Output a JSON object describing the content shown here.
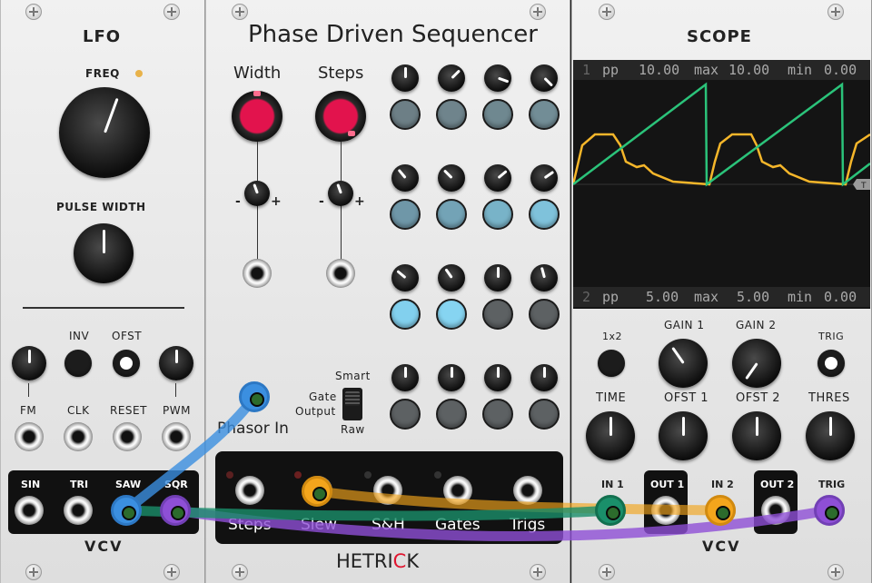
{
  "lfo": {
    "title": "LFO",
    "freq_label": "FREQ",
    "pw_label": "PULSE WIDTH",
    "inv_label": "INV",
    "ofst_label": "OFST",
    "fm_label": "FM",
    "clk_label": "CLK",
    "reset_label": "RESET",
    "pwm_label": "PWM",
    "outputs": [
      "SIN",
      "TRI",
      "SAW",
      "SQR"
    ],
    "brand": "VCV"
  },
  "sequencer": {
    "title": "Phase Driven Sequencer",
    "width_label": "Width",
    "steps_label": "Steps",
    "mode_smart": "Smart",
    "mode_gate": "Gate",
    "mode_output": "Output",
    "mode_raw": "Raw",
    "phasor_label": "Phasor In",
    "outputs": [
      "Steps",
      "Slew",
      "S&H",
      "Gates",
      "Trigs"
    ],
    "brand_a": "HETRI",
    "brand_b": "C",
    "brand_c": "K"
  },
  "scope": {
    "title": "SCOPE",
    "ch1": {
      "num": "1",
      "pp_label": "pp",
      "pp": "10.00",
      "max_label": "max",
      "max": "10.00",
      "min_label": "min",
      "min": "0.00"
    },
    "ch2": {
      "num": "2",
      "pp_label": "pp",
      "pp": "5.00",
      "max_label": "max",
      "max": "5.00",
      "min_label": "min",
      "min": "0.00"
    },
    "trig_marker": "T",
    "x2_label": "1x2",
    "gain1_label": "GAIN 1",
    "gain2_label": "GAIN 2",
    "trig_label": "TRIG",
    "time_label": "TIME",
    "ofst1_label": "OFST 1",
    "ofst2_label": "OFST 2",
    "thres_label": "THRES",
    "in1_label": "IN 1",
    "out1_label": "OUT 1",
    "in2_label": "IN 2",
    "out2_label": "OUT 2",
    "trig_in_label": "TRIG",
    "brand": "VCV"
  },
  "colors": {
    "cable_blue": "#3b8fe0",
    "cable_green": "#1a8f6a",
    "cable_orange": "#f3a51c",
    "cable_purple": "#8e4fd6",
    "trace_green": "#2bc37a",
    "trace_yellow": "#f5b62a",
    "knob_red": "#e2134d",
    "step_gray": "#6d7f86",
    "step_blue": "#7fc8e2"
  }
}
